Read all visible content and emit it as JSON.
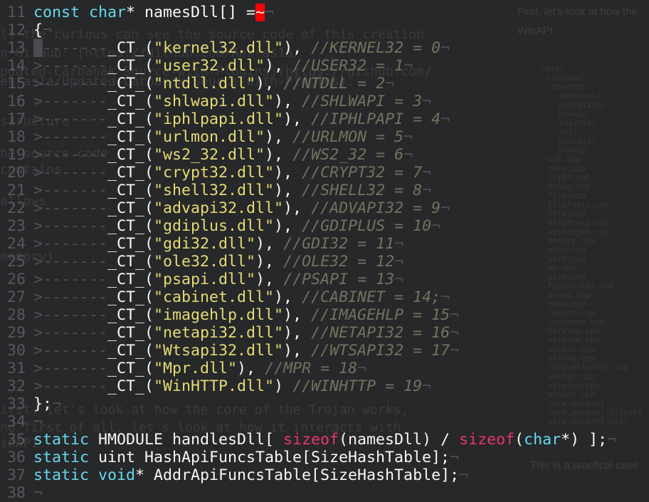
{
  "ghost": {
    "left_lines": [
      "ll the curious can see the source code of this creation",
      "n GitHub: [https://github.com/Aekras1a/",
      "pdated-Carbanak-Source-with-Plugins](https://github.com/",
      "ekras1a/Updated-Carbanak-Source-with-Plugins).",
      "structure",
      "he source code",
      "contains",
      "allows",
      "memory)",
      "irst, let's look at how the core of the Trojan works,",
      "nd first of all, let's look at how it interacts with",
      "inAPI."
    ],
    "right_text": [
      "First, let's look at how the",
      "WinAPI."
    ],
    "files": [
      "core/",
      "include/",
      "source/",
      "abstract/",
      "elevation/",
      "hooks/",
      "injects/",
      "ssl/",
      "process/",
      "proxy/",
      "cab.cpp",
      "core.cpp",
      "crypt.cpp",
      "debug.cpp",
      "file.cpp",
      "FileTools.cpp",
      "http.cpp",
      "HttpProxy.cpp",
      "keylogger.cpp",
      "memory.cpp",
      "misc.cpp",
      "path.cpp",
      "pe.cpp",
      "pipe.cpp",
      "PipeSocket.cpp",
      "proxy.cpp",
      "rand.cpp",
      "reestr.cpp",
      "runinmem.cpp",
      "Service.cpp",
      "service.cpp",
      "socket.cpp",
      "string.cpp",
      "ThroughTunnel.cpp",
      "vector.cpp",
      "version.cpp",
      "winapi.cpp",
      "core.vcxproj",
      "core.vcxproj.filters",
      "core.vcxproj.user"
    ],
    "practical_case": "This is a practical case"
  },
  "colors": {
    "background": "#27282a",
    "keyword": "#66d9ef",
    "string": "#e6db74",
    "comment": "#75715e",
    "operator": "#e8366f"
  },
  "lines": [
    {
      "n": "11",
      "t": [
        [
          "kw",
          "const"
        ],
        [
          "pl",
          " "
        ],
        [
          "kw",
          "char"
        ],
        [
          "pl",
          "* namesDll[] ="
        ],
        [
          "err",
          "~"
        ],
        [
          "eol",
          "¬"
        ]
      ]
    },
    {
      "n": "12",
      "t": [
        [
          "pl",
          "{"
        ],
        [
          "eol",
          "¬"
        ]
      ]
    },
    {
      "n": "13",
      "t": [
        [
          "tab",
          ">-------"
        ],
        [
          "pl",
          "_CT_("
        ],
        [
          "str",
          "\"kernel32.dll\""
        ],
        [
          "pl",
          "), "
        ],
        [
          "cm",
          "//KERNEL32 = 0"
        ],
        [
          "eol",
          "¬"
        ]
      ]
    },
    {
      "n": "14",
      "t": [
        [
          "tab",
          ">-------"
        ],
        [
          "pl",
          "_CT_("
        ],
        [
          "str",
          "\"user32.dll\""
        ],
        [
          "pl",
          "), "
        ],
        [
          "cm",
          "//USER32 = 1"
        ],
        [
          "eol",
          "¬"
        ]
      ]
    },
    {
      "n": "15",
      "t": [
        [
          "tab",
          ">-------"
        ],
        [
          "pl",
          "_CT_("
        ],
        [
          "str",
          "\"ntdll.dll\""
        ],
        [
          "pl",
          "), "
        ],
        [
          "cm",
          "//NTDLL = 2"
        ],
        [
          "eol",
          "¬"
        ]
      ]
    },
    {
      "n": "16",
      "t": [
        [
          "tab",
          ">-------"
        ],
        [
          "pl",
          "_CT_("
        ],
        [
          "str",
          "\"shlwapi.dll\""
        ],
        [
          "pl",
          "), "
        ],
        [
          "cm",
          "//SHLWAPI = 3"
        ],
        [
          "eol",
          "¬"
        ]
      ]
    },
    {
      "n": "17",
      "t": [
        [
          "tab",
          ">-------"
        ],
        [
          "pl",
          "_CT_("
        ],
        [
          "str",
          "\"iphlpapi.dll\""
        ],
        [
          "pl",
          "), "
        ],
        [
          "cm",
          "//IPHLPAPI = 4"
        ],
        [
          "eol",
          "¬"
        ]
      ]
    },
    {
      "n": "18",
      "t": [
        [
          "tab",
          ">-------"
        ],
        [
          "pl",
          "_CT_("
        ],
        [
          "str",
          "\"urlmon.dll\""
        ],
        [
          "pl",
          "), "
        ],
        [
          "cm",
          "//URLMON = 5"
        ],
        [
          "eol",
          "¬"
        ]
      ]
    },
    {
      "n": "19",
      "t": [
        [
          "tab",
          ">-------"
        ],
        [
          "pl",
          "_CT_("
        ],
        [
          "str",
          "\"ws2_32.dll\""
        ],
        [
          "pl",
          "), "
        ],
        [
          "cm",
          "//WS2_32 = 6"
        ],
        [
          "eol",
          "¬"
        ]
      ]
    },
    {
      "n": "20",
      "t": [
        [
          "tab",
          ">-------"
        ],
        [
          "pl",
          "_CT_("
        ],
        [
          "str",
          "\"crypt32.dll\""
        ],
        [
          "pl",
          "), "
        ],
        [
          "cm",
          "//CRYPT32 = 7"
        ],
        [
          "eol",
          "¬"
        ]
      ]
    },
    {
      "n": "21",
      "t": [
        [
          "tab",
          ">-------"
        ],
        [
          "pl",
          "_CT_("
        ],
        [
          "str",
          "\"shell32.dll\""
        ],
        [
          "pl",
          "), "
        ],
        [
          "cm",
          "//SHELL32 = 8"
        ],
        [
          "eol",
          "¬"
        ]
      ]
    },
    {
      "n": "22",
      "t": [
        [
          "tab",
          ">-------"
        ],
        [
          "pl",
          "_CT_("
        ],
        [
          "str",
          "\"advapi32.dll\""
        ],
        [
          "pl",
          "), "
        ],
        [
          "cm",
          "//ADVAPI32 = 9"
        ],
        [
          "eol",
          "¬"
        ]
      ]
    },
    {
      "n": "23",
      "t": [
        [
          "tab",
          ">-------"
        ],
        [
          "pl",
          "_CT_("
        ],
        [
          "str",
          "\"gdiplus.dll\""
        ],
        [
          "pl",
          "), "
        ],
        [
          "cm",
          "//GDIPLUS = 10"
        ],
        [
          "eol",
          "¬"
        ]
      ]
    },
    {
      "n": "24",
      "t": [
        [
          "tab",
          ">-------"
        ],
        [
          "pl",
          "_CT_("
        ],
        [
          "str",
          "\"gdi32.dll\""
        ],
        [
          "pl",
          "), "
        ],
        [
          "cm",
          "//GDI32 = 11"
        ],
        [
          "eol",
          "¬"
        ]
      ]
    },
    {
      "n": "25",
      "t": [
        [
          "tab",
          ">-------"
        ],
        [
          "pl",
          "_CT_("
        ],
        [
          "str",
          "\"ole32.dll\""
        ],
        [
          "pl",
          "), "
        ],
        [
          "cm",
          "//OLE32 = 12"
        ],
        [
          "eol",
          "¬"
        ]
      ]
    },
    {
      "n": "26",
      "t": [
        [
          "tab",
          ">-------"
        ],
        [
          "pl",
          "_CT_("
        ],
        [
          "str",
          "\"psapi.dll\""
        ],
        [
          "pl",
          "), "
        ],
        [
          "cm",
          "//PSAPI = 13"
        ],
        [
          "eol",
          "¬"
        ]
      ]
    },
    {
      "n": "27",
      "t": [
        [
          "tab",
          ">-------"
        ],
        [
          "pl",
          "_CT_("
        ],
        [
          "str",
          "\"cabinet.dll\""
        ],
        [
          "pl",
          "), "
        ],
        [
          "cm",
          "//CABINET = 14;"
        ],
        [
          "eol",
          "¬"
        ]
      ]
    },
    {
      "n": "28",
      "t": [
        [
          "tab",
          ">-------"
        ],
        [
          "pl",
          "_CT_("
        ],
        [
          "str",
          "\"imagehlp.dll\""
        ],
        [
          "pl",
          "), "
        ],
        [
          "cm",
          "//IMAGEHLP = 15"
        ],
        [
          "eol",
          "¬"
        ]
      ]
    },
    {
      "n": "29",
      "t": [
        [
          "tab",
          ">-------"
        ],
        [
          "pl",
          "_CT_("
        ],
        [
          "str",
          "\"netapi32.dll\""
        ],
        [
          "pl",
          "), "
        ],
        [
          "cm",
          "//NETAPI32 = 16"
        ],
        [
          "eol",
          "¬"
        ]
      ]
    },
    {
      "n": "30",
      "t": [
        [
          "tab",
          ">-------"
        ],
        [
          "pl",
          "_CT_("
        ],
        [
          "str",
          "\"Wtsapi32.dll\""
        ],
        [
          "pl",
          "), "
        ],
        [
          "cm",
          "//WTSAPI32 = 17"
        ],
        [
          "eol",
          "¬"
        ]
      ]
    },
    {
      "n": "31",
      "t": [
        [
          "tab",
          ">-------"
        ],
        [
          "pl",
          "_CT_("
        ],
        [
          "str",
          "\"Mpr.dll\""
        ],
        [
          "pl",
          "), "
        ],
        [
          "cm",
          "//MPR = 18"
        ],
        [
          "eol",
          "¬"
        ]
      ]
    },
    {
      "n": "32",
      "t": [
        [
          "tab",
          ">-------"
        ],
        [
          "pl",
          "_CT_("
        ],
        [
          "str",
          "\"WinHTTP.dll\""
        ],
        [
          "pl",
          ") "
        ],
        [
          "cm",
          "//WINHTTP = 19"
        ],
        [
          "eol",
          "¬"
        ]
      ]
    },
    {
      "n": "33",
      "t": [
        [
          "pl",
          "};"
        ],
        [
          "eol",
          "¬"
        ]
      ]
    },
    {
      "n": "34",
      "t": [
        [
          "eol",
          "¬"
        ]
      ]
    },
    {
      "n": "35",
      "t": [
        [
          "kw",
          "static"
        ],
        [
          "pl",
          " HMODULE handlesDll[ "
        ],
        [
          "op",
          "sizeof"
        ],
        [
          "pl",
          "(namesDll) / "
        ],
        [
          "op",
          "sizeof"
        ],
        [
          "pl",
          "("
        ],
        [
          "kw",
          "char"
        ],
        [
          "pl",
          "*) ];"
        ],
        [
          "eol",
          "¬"
        ]
      ]
    },
    {
      "n": "36",
      "t": [
        [
          "kw",
          "static"
        ],
        [
          "pl",
          " uint HashApiFuncsTable[SizeHashTable];"
        ],
        [
          "eol",
          "¬"
        ]
      ]
    },
    {
      "n": "37",
      "t": [
        [
          "kw",
          "static"
        ],
        [
          "pl",
          " "
        ],
        [
          "kw",
          "void"
        ],
        [
          "pl",
          "* AddrApiFuncsTable[SizeHashTable];"
        ],
        [
          "eol",
          "¬"
        ]
      ]
    },
    {
      "n": "38",
      "t": [
        [
          "eol",
          "¬"
        ]
      ]
    }
  ]
}
